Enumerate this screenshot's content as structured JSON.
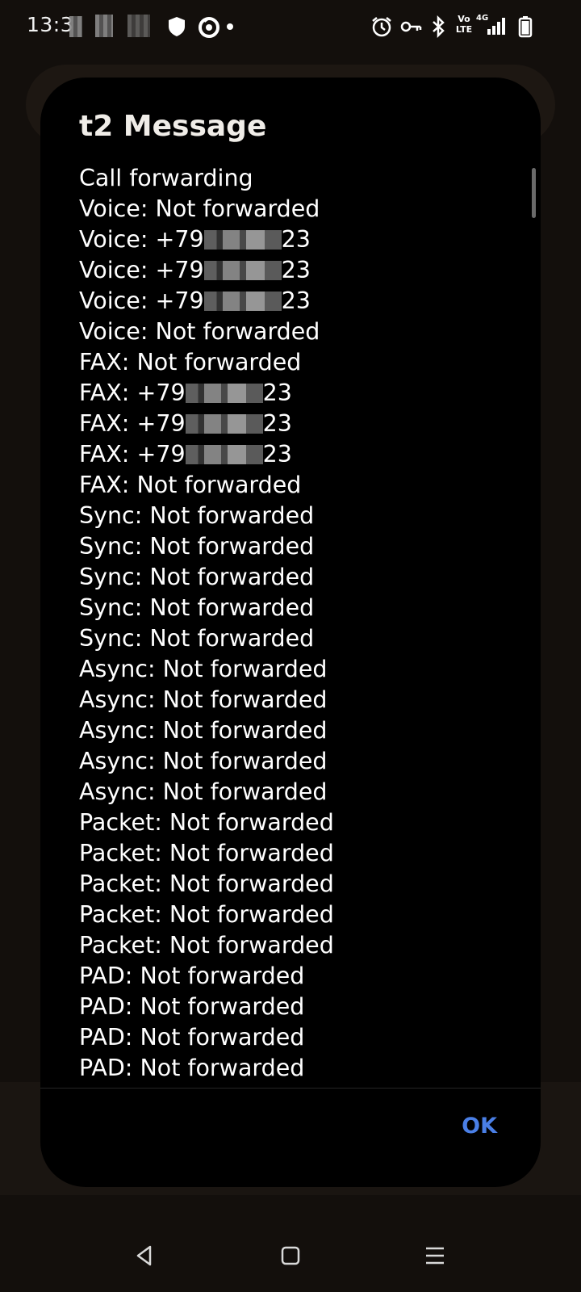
{
  "status_bar": {
    "time": "13:3",
    "icons": [
      "image-icon",
      "image-icon",
      "shield-icon",
      "firefox-icon",
      "alarm-icon",
      "vpn-key-icon",
      "bluetooth-icon",
      "volte-icon",
      "signal-icon",
      "battery-icon"
    ],
    "volte_label": "Vo LTE",
    "network_label": "4G"
  },
  "dialog": {
    "title": "t2 Message",
    "lines": [
      {
        "prefix": "Call forwarding"
      },
      {
        "prefix": "Voice: Not forwarded"
      },
      {
        "prefix": "Voice: +79",
        "suffix": "23",
        "redacted": true
      },
      {
        "prefix": "Voice: +79",
        "suffix": "23",
        "redacted": true
      },
      {
        "prefix": "Voice: +79",
        "suffix": "23",
        "redacted": true
      },
      {
        "prefix": "Voice: Not forwarded"
      },
      {
        "prefix": "FAX: Not forwarded"
      },
      {
        "prefix": "FAX: +79",
        "suffix": "23",
        "redacted": true
      },
      {
        "prefix": "FAX: +79",
        "suffix": "23",
        "redacted": true
      },
      {
        "prefix": "FAX: +79",
        "suffix": "23",
        "redacted": true
      },
      {
        "prefix": "FAX: Not forwarded"
      },
      {
        "prefix": "Sync: Not forwarded"
      },
      {
        "prefix": "Sync: Not forwarded"
      },
      {
        "prefix": "Sync: Not forwarded"
      },
      {
        "prefix": "Sync: Not forwarded"
      },
      {
        "prefix": "Sync: Not forwarded"
      },
      {
        "prefix": "Async: Not forwarded"
      },
      {
        "prefix": "Async: Not forwarded"
      },
      {
        "prefix": "Async: Not forwarded"
      },
      {
        "prefix": "Async: Not forwarded"
      },
      {
        "prefix": "Async: Not forwarded"
      },
      {
        "prefix": "Packet: Not forwarded"
      },
      {
        "prefix": "Packet: Not forwarded"
      },
      {
        "prefix": "Packet: Not forwarded"
      },
      {
        "prefix": "Packet: Not forwarded"
      },
      {
        "prefix": "Packet: Not forwarded"
      },
      {
        "prefix": "PAD: Not forwarded"
      },
      {
        "prefix": "PAD: Not forwarded"
      },
      {
        "prefix": "PAD: Not forwarded"
      },
      {
        "prefix": "PAD: Not forwarded"
      }
    ],
    "ok_label": "OK"
  },
  "nav_bar": {
    "buttons": [
      "back-icon",
      "home-icon",
      "recents-icon"
    ]
  },
  "colors": {
    "background": "#130f0c",
    "dialog": "#000000",
    "accent": "#4a7fe6"
  }
}
